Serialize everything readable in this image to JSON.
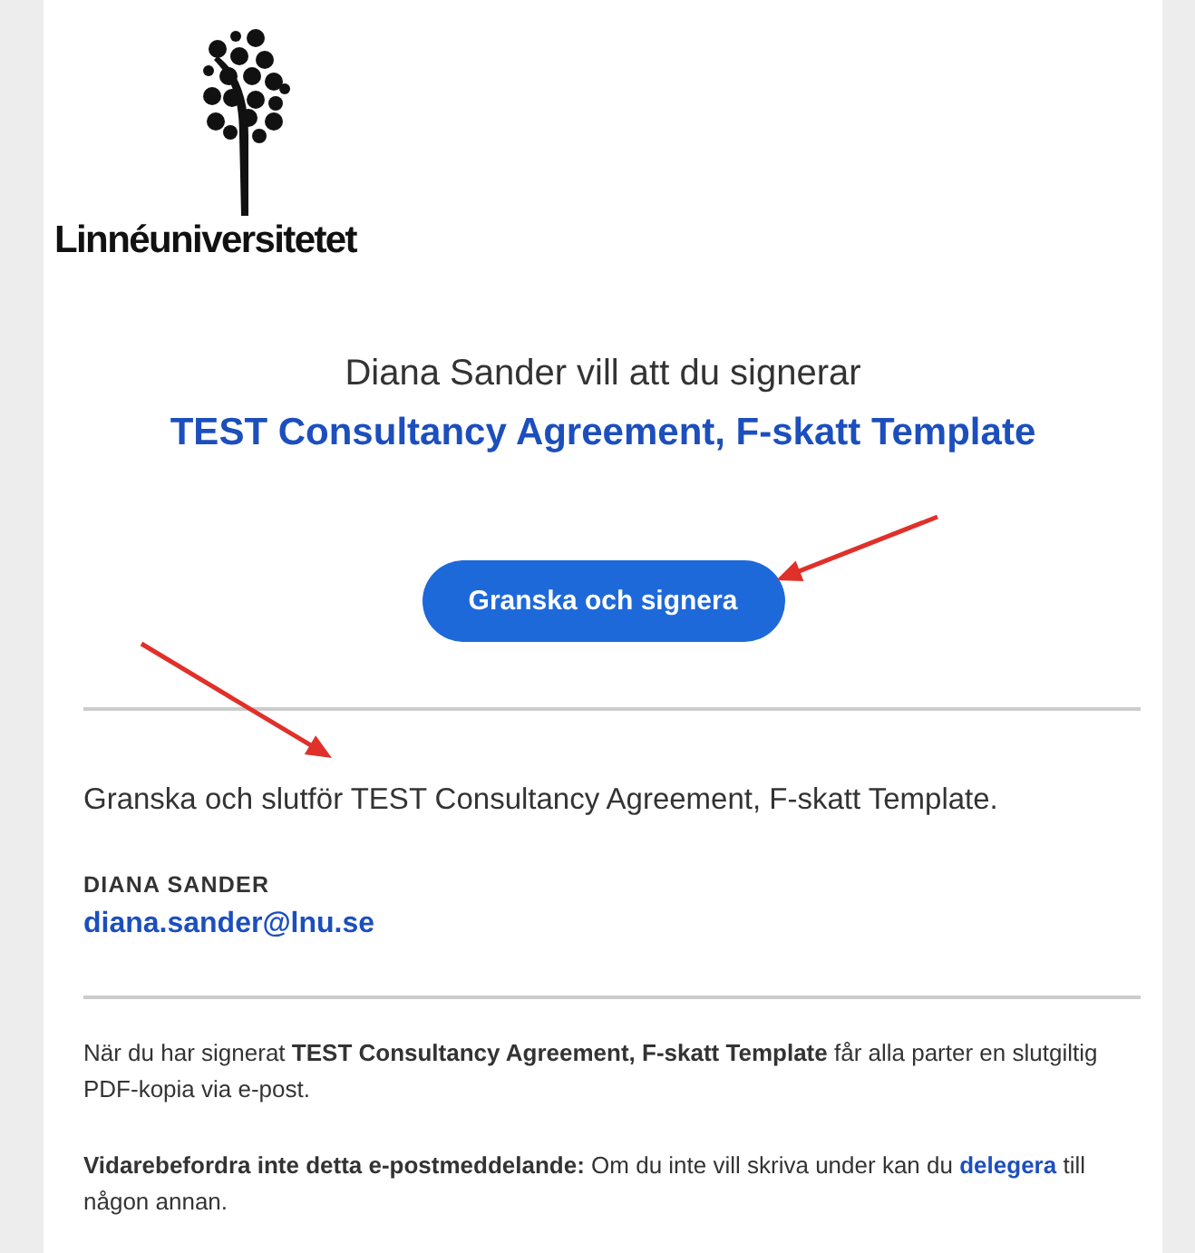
{
  "logo": {
    "name": "Linnéuniversitetet"
  },
  "heading": "Diana Sander vill att du signerar",
  "document_title": "TEST Consultancy Agreement, F-skatt Template",
  "button": "Granska och signera",
  "intro": "Granska och slutför TEST Consultancy Agreement, F-skatt Template.",
  "sender": {
    "name": "DIANA SANDER",
    "email": "diana.sander@lnu.se"
  },
  "note": "När du har signerat **TEST Consultancy Agreement, F-skatt Template** får alla parter en slutgiltig PDF-kopia via e-post.",
  "warning": {
    "text": "**Vidarebefordra inte detta e-postmeddelande:** Om du inte vill skriva under kan du",
    "link": "delegera",
    "rest": "till någon annan."
  },
  "annotations": [
    {
      "kind": "arrow"
    },
    {
      "kind": "arrow"
    }
  ]
}
